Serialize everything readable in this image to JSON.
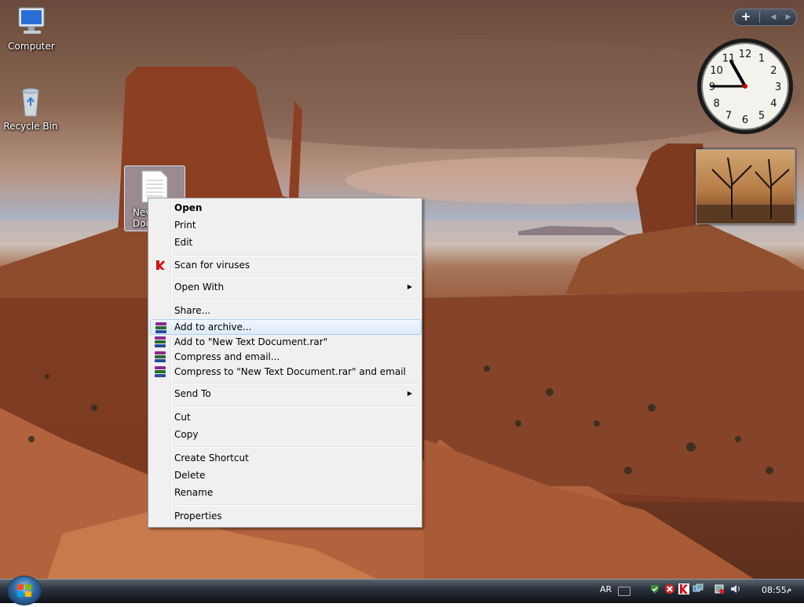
{
  "desktop": {
    "icons": [
      {
        "label": "Computer"
      },
      {
        "label": "Recycle Bin"
      },
      {
        "label_line1": "Nev",
        "label_line2": "Doc"
      }
    ]
  },
  "sidebar": {
    "add_label": "+",
    "prev_label": "◀",
    "next_label": "▶",
    "clock": {
      "numerals": [
        "12",
        "1",
        "2",
        "3",
        "4",
        "5",
        "6",
        "7",
        "8",
        "9",
        "10",
        "11"
      ]
    }
  },
  "context_menu": {
    "items": [
      {
        "label": "Open"
      },
      {
        "label": "Print"
      },
      {
        "label": "Edit"
      },
      {
        "label": "Scan for viruses"
      },
      {
        "label": "Open With",
        "submenu": true
      },
      {
        "label": "Share..."
      },
      {
        "label": "Add to archive..."
      },
      {
        "label": "Add to \"New Text Document.rar\""
      },
      {
        "label": "Compress and email..."
      },
      {
        "label": "Compress to \"New Text Document.rar\" and email"
      },
      {
        "label": "Send To",
        "submenu": true
      },
      {
        "label": "Cut"
      },
      {
        "label": "Copy"
      },
      {
        "label": "Create Shortcut"
      },
      {
        "label": "Delete"
      },
      {
        "label": "Rename"
      },
      {
        "label": "Properties"
      }
    ],
    "submenu_arrow": "▶"
  },
  "taskbar": {
    "language": "AR",
    "time": "08:55",
    "ampm": "م"
  },
  "colors": {
    "menu_bg": "#f0f0f0",
    "menu_hover": "#dbeaf9",
    "taskbar": "#1b2128"
  }
}
